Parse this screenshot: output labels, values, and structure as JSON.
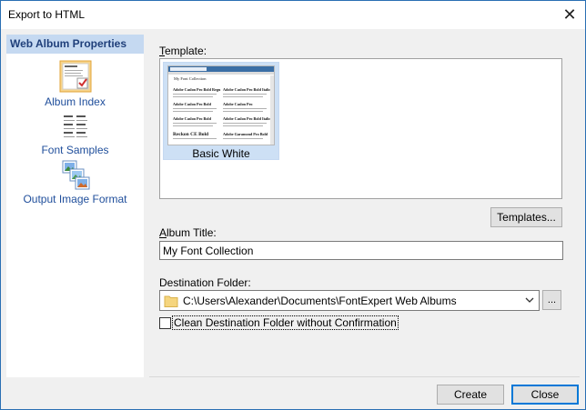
{
  "window": {
    "title": "Export to HTML",
    "close_glyph": "✕"
  },
  "sidebar": {
    "header": "Web Album Properties",
    "items": [
      {
        "label": "Album Index",
        "icon": "album-index-icon"
      },
      {
        "label": "Font Samples",
        "icon": "font-samples-icon"
      },
      {
        "label": "Output Image Format",
        "icon": "output-image-format-icon"
      }
    ]
  },
  "template": {
    "label_first": "T",
    "label_rest": "emplate:",
    "items": [
      {
        "caption": "Basic White",
        "selected": true
      }
    ],
    "thumb_title": "My Font Collection",
    "thumb_lines": [
      "Adobe Caslon Pro Bold Regu",
      "Adobe Caslon Pro Bold Italic",
      "Adobe Caslon Pro Bold",
      "Adobe Caslon Pro",
      "Adobe Caslon Pro Bold",
      "Adobe Caslon Pro Bold Italic",
      "Reckon CE Bold",
      "Adobe Garamond Pro Bold"
    ],
    "templates_button": "Templates..."
  },
  "album_title": {
    "label_first": "A",
    "label_rest": "lbum Title:",
    "value": "My Font Collection"
  },
  "destination": {
    "label": "Destination Folder:",
    "value": "C:\\Users\\Alexander\\Documents\\FontExpert Web Albums",
    "browse_label": "..."
  },
  "clean_option": {
    "label": "Clean Destination Folder without Confirmation",
    "checked": false
  },
  "footer": {
    "create_label": "Create",
    "close_label": "Close"
  },
  "colors": {
    "accent": "#0078d7",
    "sidebar_header_bg": "#c5d9f1",
    "sidebar_link": "#1f4e9b"
  }
}
